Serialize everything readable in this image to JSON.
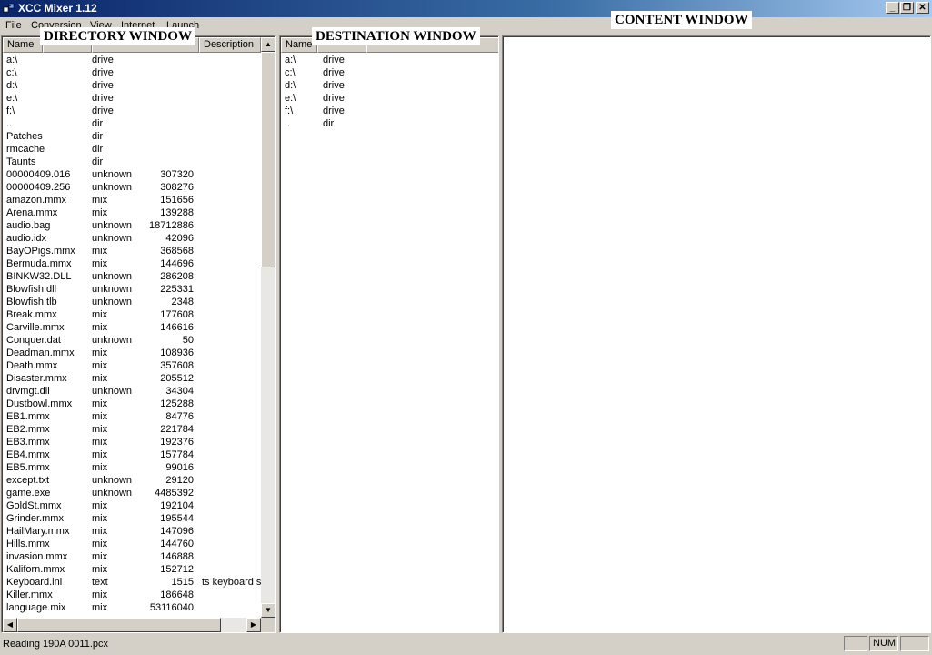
{
  "window": {
    "title": "XCC Mixer 1.12",
    "minimize": "_",
    "restore": "❐",
    "close": "✕"
  },
  "menu": [
    "File",
    "Conversion",
    "View",
    "Internet",
    "Launch"
  ],
  "labels": {
    "directory": "DIRECTORY WINDOW",
    "destination": "DESTINATION WINDOW",
    "content": "CONTENT WINDOW"
  },
  "directory_pane": {
    "columns": [
      "Name",
      "",
      "",
      "Description"
    ],
    "rows": [
      [
        "a:\\",
        "drive",
        "",
        ""
      ],
      [
        "c:\\",
        "drive",
        "",
        ""
      ],
      [
        "d:\\",
        "drive",
        "",
        ""
      ],
      [
        "e:\\",
        "drive",
        "",
        ""
      ],
      [
        "f:\\",
        "drive",
        "",
        ""
      ],
      [
        "..",
        "dir",
        "",
        ""
      ],
      [
        "Patches",
        "dir",
        "",
        ""
      ],
      [
        "rmcache",
        "dir",
        "",
        ""
      ],
      [
        "Taunts",
        "dir",
        "",
        ""
      ],
      [
        "00000409.016",
        "unknown",
        "307320",
        ""
      ],
      [
        "00000409.256",
        "unknown",
        "308276",
        ""
      ],
      [
        "amazon.mmx",
        "mix",
        "151656",
        ""
      ],
      [
        "Arena.mmx",
        "mix",
        "139288",
        ""
      ],
      [
        "audio.bag",
        "unknown",
        "18712886",
        ""
      ],
      [
        "audio.idx",
        "unknown",
        "42096",
        ""
      ],
      [
        "BayOPigs.mmx",
        "mix",
        "368568",
        ""
      ],
      [
        "Bermuda.mmx",
        "mix",
        "144696",
        ""
      ],
      [
        "BINKW32.DLL",
        "unknown",
        "286208",
        ""
      ],
      [
        "Blowfish.dll",
        "unknown",
        "225331",
        ""
      ],
      [
        "Blowfish.tlb",
        "unknown",
        "2348",
        ""
      ],
      [
        "Break.mmx",
        "mix",
        "177608",
        ""
      ],
      [
        "Carville.mmx",
        "mix",
        "146616",
        ""
      ],
      [
        "Conquer.dat",
        "unknown",
        "50",
        ""
      ],
      [
        "Deadman.mmx",
        "mix",
        "108936",
        ""
      ],
      [
        "Death.mmx",
        "mix",
        "357608",
        ""
      ],
      [
        "Disaster.mmx",
        "mix",
        "205512",
        ""
      ],
      [
        "drvmgt.dll",
        "unknown",
        "34304",
        ""
      ],
      [
        "Dustbowl.mmx",
        "mix",
        "125288",
        ""
      ],
      [
        "EB1.mmx",
        "mix",
        "84776",
        ""
      ],
      [
        "EB2.mmx",
        "mix",
        "221784",
        ""
      ],
      [
        "EB3.mmx",
        "mix",
        "192376",
        ""
      ],
      [
        "EB4.mmx",
        "mix",
        "157784",
        ""
      ],
      [
        "EB5.mmx",
        "mix",
        "99016",
        ""
      ],
      [
        "except.txt",
        "unknown",
        "29120",
        ""
      ],
      [
        "game.exe",
        "unknown",
        "4485392",
        ""
      ],
      [
        "GoldSt.mmx",
        "mix",
        "192104",
        ""
      ],
      [
        "Grinder.mmx",
        "mix",
        "195544",
        ""
      ],
      [
        "HailMary.mmx",
        "mix",
        "147096",
        ""
      ],
      [
        "Hills.mmx",
        "mix",
        "144760",
        ""
      ],
      [
        "invasion.mmx",
        "mix",
        "146888",
        ""
      ],
      [
        "Kaliforn.mmx",
        "mix",
        "152712",
        ""
      ],
      [
        "Keyboard.ini",
        "text",
        "1515",
        "ts keyboard s"
      ],
      [
        "Killer.mmx",
        "mix",
        "186648",
        ""
      ],
      [
        "language.mix",
        "mix",
        "53116040",
        ""
      ]
    ]
  },
  "destination_pane": {
    "columns": [
      "Name",
      "",
      ""
    ],
    "rows": [
      [
        "a:\\",
        "drive"
      ],
      [
        "c:\\",
        "drive"
      ],
      [
        "d:\\",
        "drive"
      ],
      [
        "e:\\",
        "drive"
      ],
      [
        "f:\\",
        "drive"
      ],
      [
        "..",
        "dir"
      ]
    ]
  },
  "scroll": {
    "up": "▲",
    "down": "▼",
    "left": "◀",
    "right": "▶"
  },
  "status": {
    "text": "Reading 190A 0011.pcx",
    "num": "NUM"
  }
}
